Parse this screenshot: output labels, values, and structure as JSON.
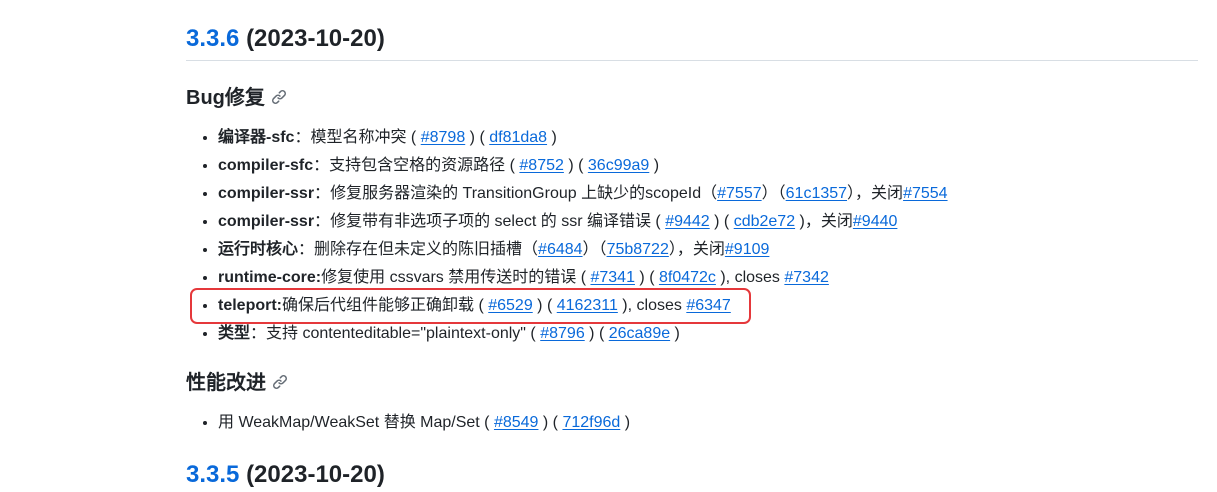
{
  "release": {
    "version": "3.3.6",
    "date": "(2023-10-20)"
  },
  "bugfix_section": {
    "title": "Bug修复"
  },
  "bugfix_items": [
    {
      "label": "编译器-sfc",
      "sep": "：",
      "text": "模型名称冲突 ( ",
      "pr": "#8798",
      "mid": " ) ( ",
      "commit": "df81da8",
      "tail": " )",
      "closes_label": "",
      "closes": "",
      "end": ""
    },
    {
      "label": "compiler-sfc",
      "sep": "：",
      "text": "支持包含空格的资源路径 ( ",
      "pr": "#8752",
      "mid": " ) ( ",
      "commit": "36c99a9",
      "tail": " )",
      "closes_label": "",
      "closes": "",
      "end": ""
    },
    {
      "label": "compiler-ssr",
      "sep": "：",
      "text": "修复服务器渲染的 TransitionGroup 上缺少的scopeId（",
      "pr": "#7557",
      "mid": "）（",
      "commit": "61c1357",
      "tail": "），",
      "closes_label": "关闭",
      "closes": "#7554",
      "end": ""
    },
    {
      "label": "compiler-ssr",
      "sep": "：",
      "text": "修复带有非选项子项的 select 的 ssr 编译错误 ( ",
      "pr": "#9442",
      "mid": " ) ( ",
      "commit": "cdb2e72",
      "tail": " )，",
      "closes_label": "关闭",
      "closes": "#9440",
      "end": ""
    },
    {
      "label": "运行时核心",
      "sep": "：",
      "text": "删除存在但未定义的陈旧插槽（",
      "pr": "#6484",
      "mid": "）（",
      "commit": "75b8722",
      "tail": "），",
      "closes_label": "关闭",
      "closes": "#9109",
      "end": ""
    },
    {
      "label": "runtime-core:",
      "sep": "",
      "text": "修复使用 cssvars 禁用传送时的错误 ( ",
      "pr": "#7341",
      "mid": " ) ( ",
      "commit": "8f0472c",
      "tail": " ), ",
      "closes_label": "closes ",
      "closes": "#7342",
      "end": ""
    },
    {
      "label": "teleport:",
      "sep": "",
      "text": "确保后代组件能够正确卸载 ( ",
      "pr": "#6529",
      "mid": " ) ( ",
      "commit": "4162311",
      "tail": " ), ",
      "closes_label": "closes ",
      "closes": "#6347",
      "end": ""
    },
    {
      "label": "类型",
      "sep": "：",
      "text": "支持 contenteditable=\"plaintext-only\" ( ",
      "pr": "#8796",
      "mid": " ) ( ",
      "commit": "26ca89e",
      "tail": " )",
      "closes_label": "",
      "closes": "",
      "end": ""
    }
  ],
  "perf_section": {
    "title": "性能改进"
  },
  "perf_items": [
    {
      "text": "用 WeakMap/WeakSet 替换 Map/Set ( ",
      "pr": "#8549",
      "mid": " ) ( ",
      "commit": "712f96d",
      "tail": " )"
    }
  ],
  "next_release": {
    "version": "3.3.5",
    "date": "(2023-10-20)"
  },
  "highlight": {
    "color": "#e5383b"
  },
  "icons": {
    "anchor": "link-icon"
  }
}
